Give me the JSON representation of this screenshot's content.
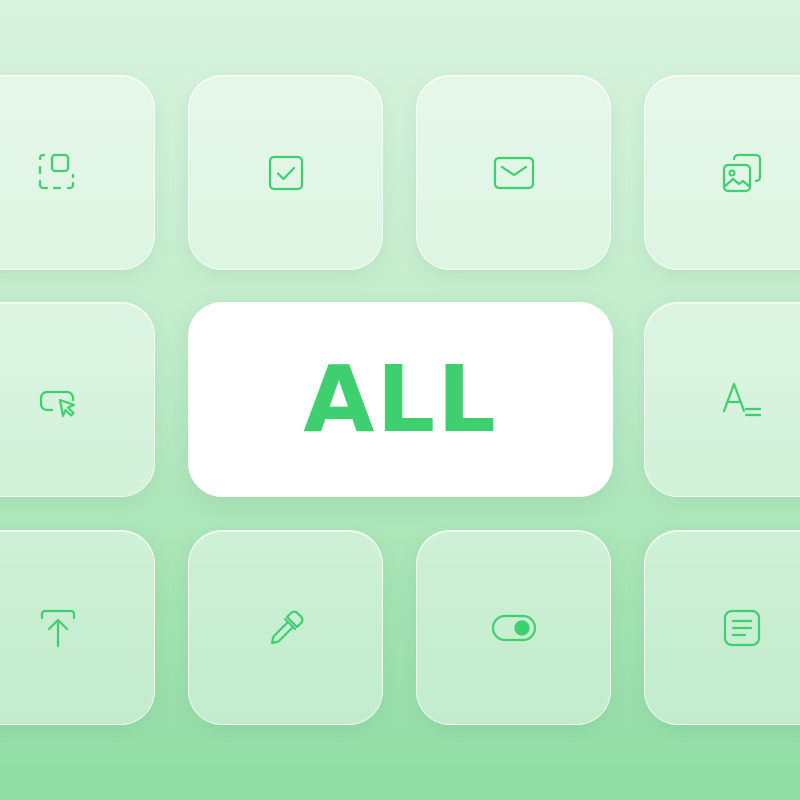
{
  "theme": {
    "accent": "#3ecf6e",
    "background_top": "#d9f3df",
    "background_bottom": "#8fdca4",
    "tile_fill": "rgba(255,255,255,0.42)",
    "center_tile_fill": "#ffffff"
  },
  "center_button": {
    "label": "ALL"
  },
  "icon_grid": {
    "row_1": [
      "select-area-icon",
      "checkbox-icon",
      "mail-icon",
      "gallery-icon"
    ],
    "row_2": [
      "click-cursor-icon",
      "text-style-icon"
    ],
    "row_3": [
      "upload-icon",
      "eyedropper-icon",
      "toggle-icon",
      "document-icon"
    ]
  }
}
